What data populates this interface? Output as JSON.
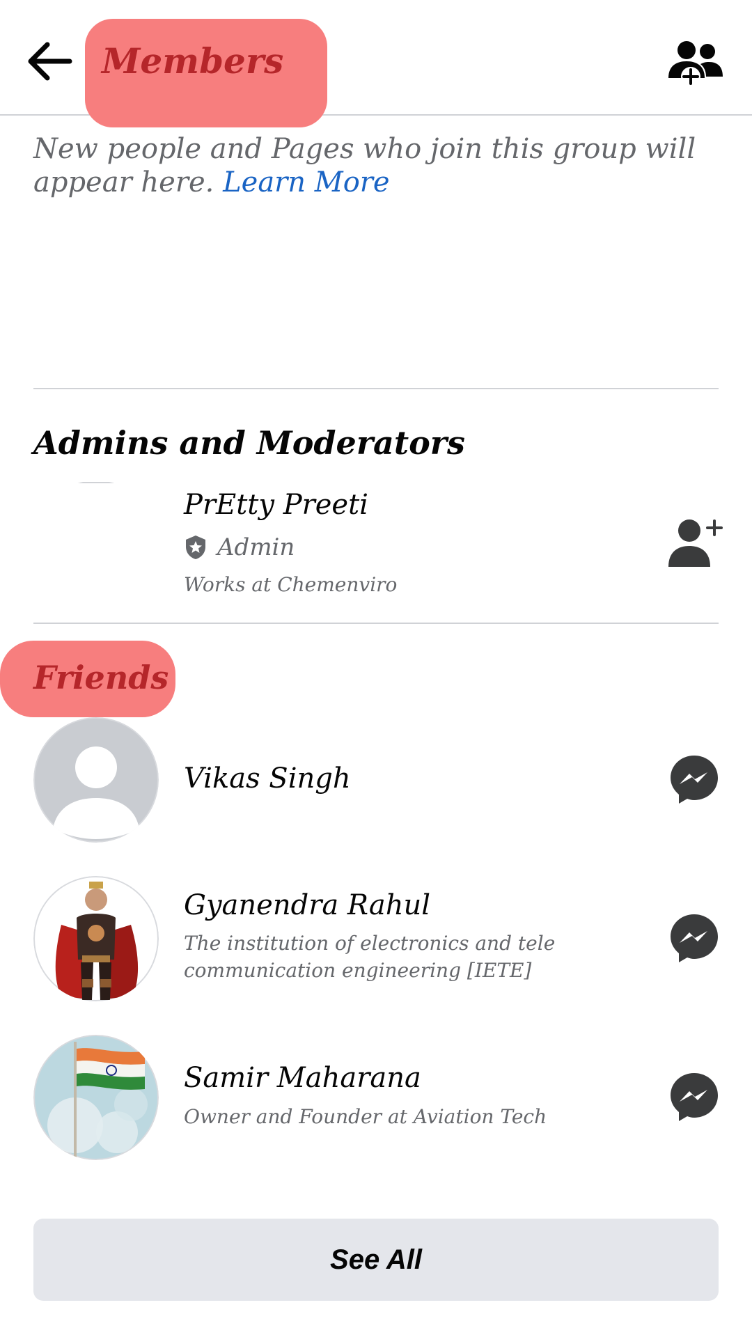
{
  "header": {
    "title": "Members",
    "back_icon": "arrow-left-icon",
    "add_members_icon": "group-add-icon"
  },
  "intro": {
    "text": "New people and Pages who join this group will appear here.",
    "link_label": "Learn More"
  },
  "admins": {
    "heading": "Admins and Moderators",
    "members": [
      {
        "name": "PrEtty Preeti",
        "role": "Admin",
        "detail": "Works at Chemenviro",
        "action_icon": "add-friend-icon"
      }
    ]
  },
  "friends": {
    "heading": "Friends",
    "members": [
      {
        "name": "Vikas Singh",
        "detail": "",
        "action_icon": "messenger-icon"
      },
      {
        "name": "Gyanendra Rahul",
        "detail_line1": "The institution of electronics and tele",
        "detail_line2": "communication engineering [IETE]",
        "action_icon": "messenger-icon"
      },
      {
        "name": "Samir Maharana",
        "detail": "Owner and Founder at Aviation Tech",
        "action_icon": "messenger-icon"
      }
    ]
  },
  "see_all_label": "See All",
  "colors": {
    "highlight": "#f77e7e",
    "highlight_text": "#b5262a",
    "link": "#1a64c4",
    "secondary_text": "#65676b",
    "button_bg": "#e4e6eb",
    "icon_dark": "#3a3b3c"
  }
}
